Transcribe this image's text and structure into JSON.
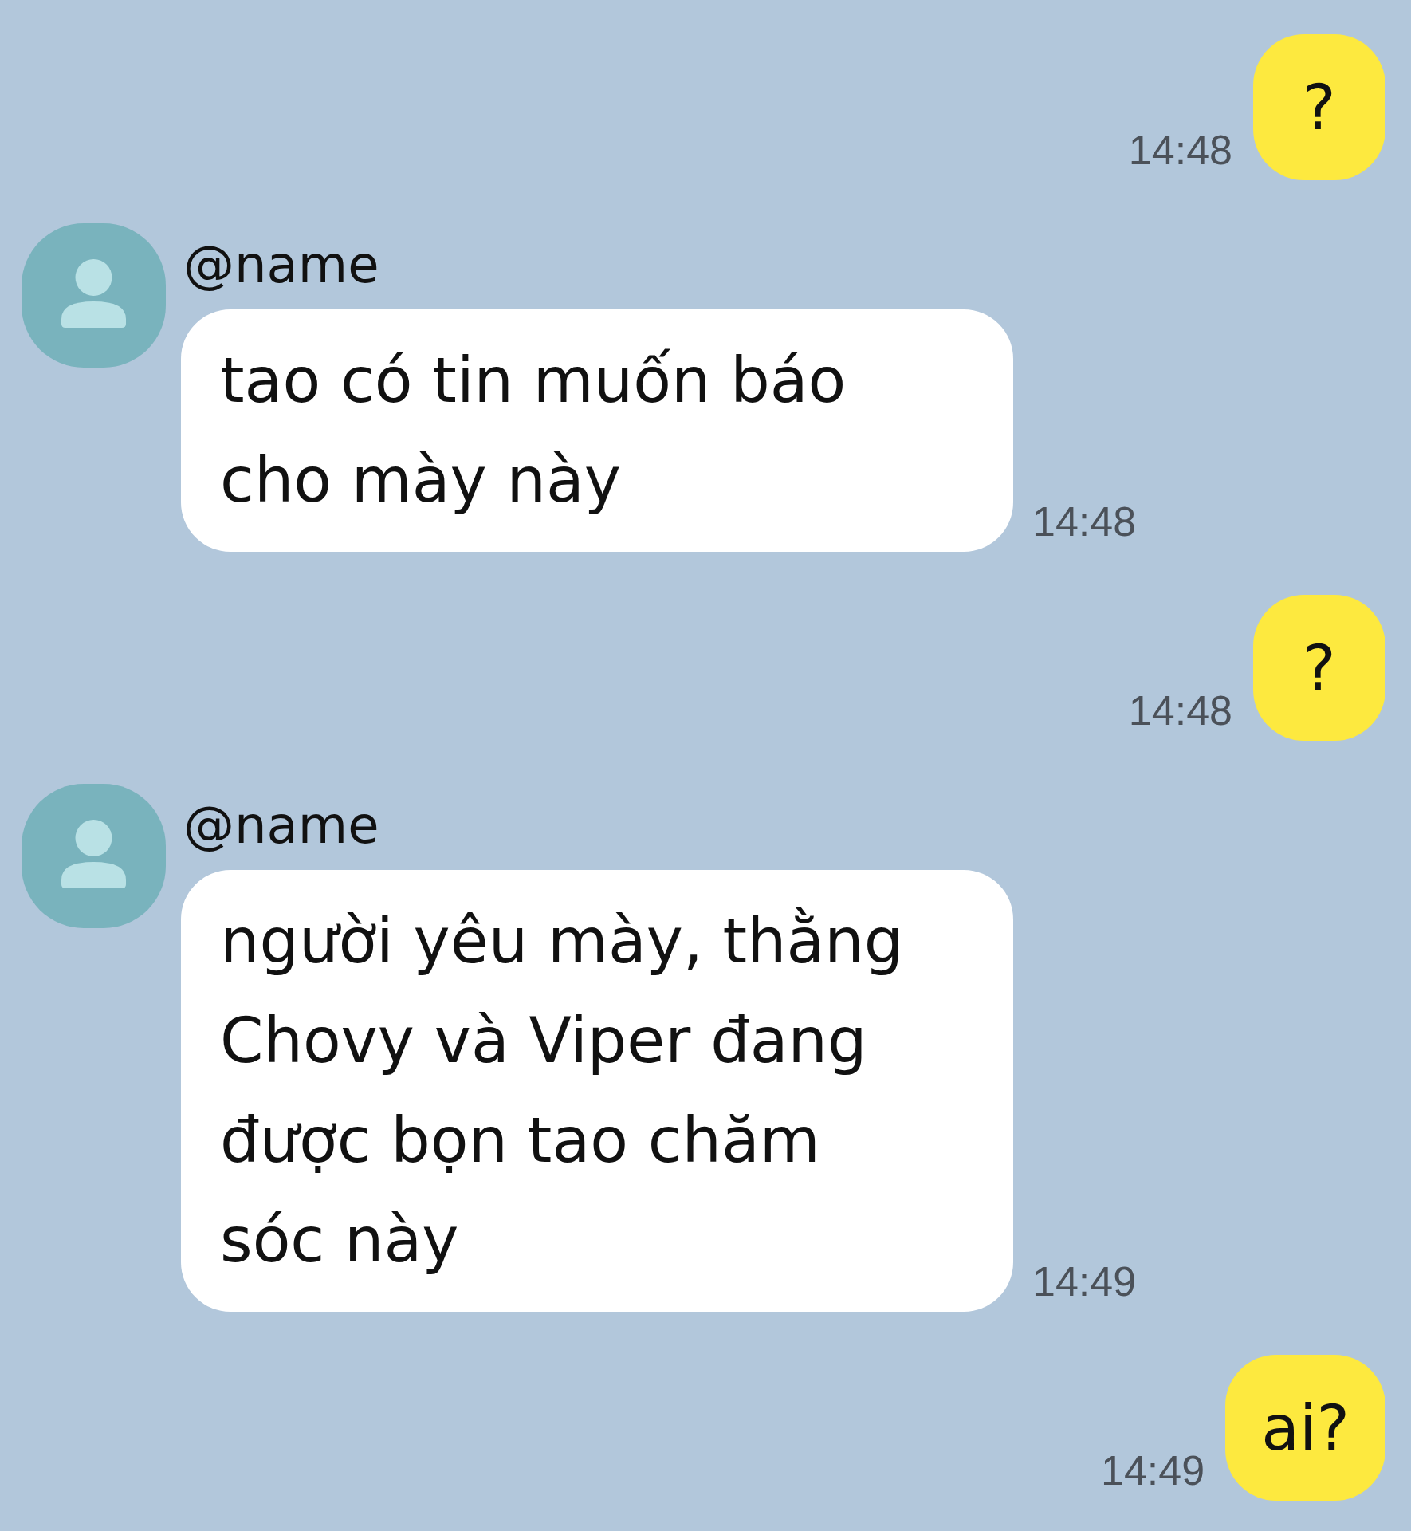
{
  "messages": [
    {
      "kind": "sent",
      "text": "?",
      "time": "14:48"
    },
    {
      "kind": "received",
      "sender": "@name",
      "text": "tao có tin muốn báo\ncho mày này",
      "time": "14:48"
    },
    {
      "kind": "sent",
      "text": "?",
      "time": "14:48"
    },
    {
      "kind": "received",
      "sender": "@name",
      "text": "người yêu mày, thằng\nChovy và Viper đang\nđược bọn tao chăm\nsóc này",
      "time": "14:49"
    },
    {
      "kind": "sent",
      "text": "ai?",
      "time": "14:49"
    }
  ]
}
